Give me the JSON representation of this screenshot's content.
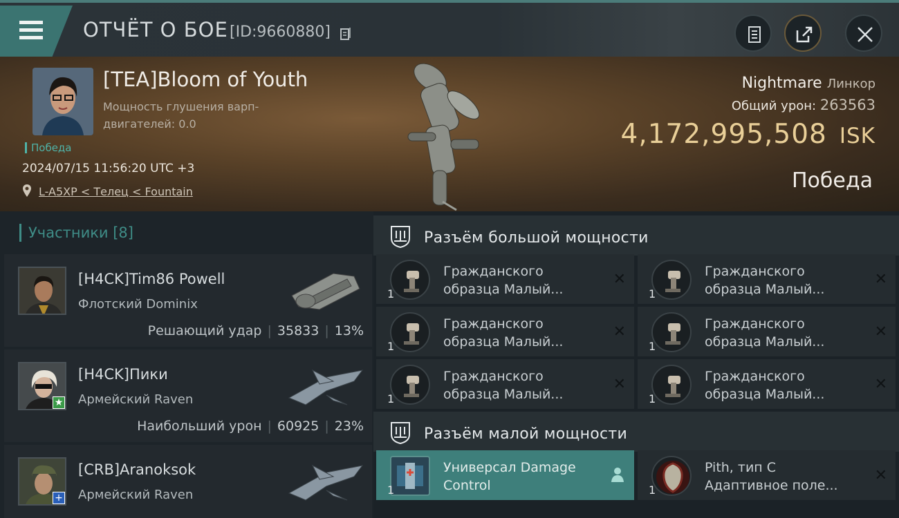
{
  "header": {
    "title": "ОТЧЁТ О БОЕ",
    "battle_id": "[ID:9660880]",
    "icons": [
      "menu-icon",
      "copy-icon",
      "clipboard-icon",
      "share-icon",
      "close-icon"
    ]
  },
  "victim": {
    "name": "[TEA]Bloom of Youth",
    "jam_label": "Мощность глушения варп-двигателей: 0.0",
    "result_tag": "Победа",
    "datetime": "2024/07/15 11:56:20 UTC +3",
    "location": "L-A5XP < Телец < Fountain",
    "ship_name": "Nightmare",
    "ship_class": "Линкор",
    "total_damage_label": "Общий урон:",
    "total_damage_value": "263563",
    "isk_value": "4,172,995,508",
    "isk_unit": "ISK",
    "outcome": "Победа"
  },
  "participants": {
    "label": "Участники [8]",
    "rows": [
      {
        "name": "[H4CK]Tim86 Powell",
        "ship": "Флотский Dominix",
        "stat_label": "Решающий удар",
        "damage": "35833",
        "percent": "13%"
      },
      {
        "name": "[H4CK]Пики",
        "ship": "Армейский Raven",
        "stat_label": "Наибольший урон",
        "damage": "60925",
        "percent": "23%"
      },
      {
        "name": "[CRB]Aranoksok",
        "ship": "Армейский Raven",
        "stat_label": "",
        "damage": "",
        "percent": ""
      }
    ]
  },
  "slots": {
    "high": {
      "label": "Разъём большой мощности",
      "modules": [
        {
          "qty": "1",
          "line1": "Гражданского",
          "line2": "образца Малый..."
        },
        {
          "qty": "1",
          "line1": "Гражданского",
          "line2": "образца Малый..."
        },
        {
          "qty": "1",
          "line1": "Гражданского",
          "line2": "образца Малый..."
        },
        {
          "qty": "1",
          "line1": "Гражданского",
          "line2": "образца Малый..."
        },
        {
          "qty": "1",
          "line1": "Гражданского",
          "line2": "образца Малый..."
        },
        {
          "qty": "1",
          "line1": "Гражданского",
          "line2": "образца Малый..."
        }
      ]
    },
    "low": {
      "label": "Разъём малой мощности",
      "modules": [
        {
          "qty": "1",
          "line1": "Универсал Damage",
          "line2": "Control"
        },
        {
          "qty": "1",
          "line1": "Pith, тип C",
          "line2": "Адаптивное поле..."
        }
      ]
    }
  },
  "colors": {
    "accent_teal": "#3f8d87",
    "isk_gold": "#e9cf98",
    "active_module": "#3e7f7b"
  }
}
